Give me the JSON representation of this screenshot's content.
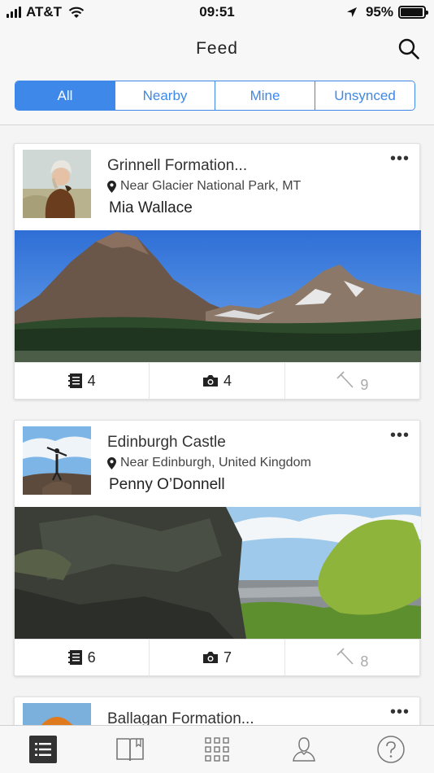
{
  "status": {
    "carrier": "AT&T",
    "time": "09:51",
    "battery": "95%",
    "battery_level": 0.95
  },
  "nav": {
    "title": "Feed",
    "segments": [
      {
        "label": "All",
        "active": true
      },
      {
        "label": "Nearby",
        "active": false
      },
      {
        "label": "Mine",
        "active": false
      },
      {
        "label": "Unsynced",
        "active": false
      }
    ]
  },
  "feed": [
    {
      "title": "Grinnell Formation...",
      "location": "Near Glacier National Park, MT",
      "user": "Mia Wallace",
      "notes": "4",
      "photos": "4",
      "samples": "9"
    },
    {
      "title": "Edinburgh Castle",
      "location": "Near Edinburgh, United Kingdom",
      "user": "Penny O’Donnell",
      "notes": "6",
      "photos": "7",
      "samples": "8"
    },
    {
      "title": "Ballagan Formation..."
    }
  ],
  "more_glyph": "•••",
  "icons": {
    "signal": "signal-icon",
    "wifi": "wifi-icon",
    "location": "location-arrow-icon",
    "search": "search-icon",
    "notes": "notes-icon",
    "camera": "camera-icon",
    "hammer": "rock-hammer-icon",
    "pin": "map-pin-icon",
    "tabs": [
      "feed-list-icon",
      "notebook-icon",
      "grid-icon",
      "profile-icon",
      "help-icon"
    ]
  },
  "colors": {
    "accent": "#3d88e9",
    "active_tab_bg": "#333333"
  }
}
